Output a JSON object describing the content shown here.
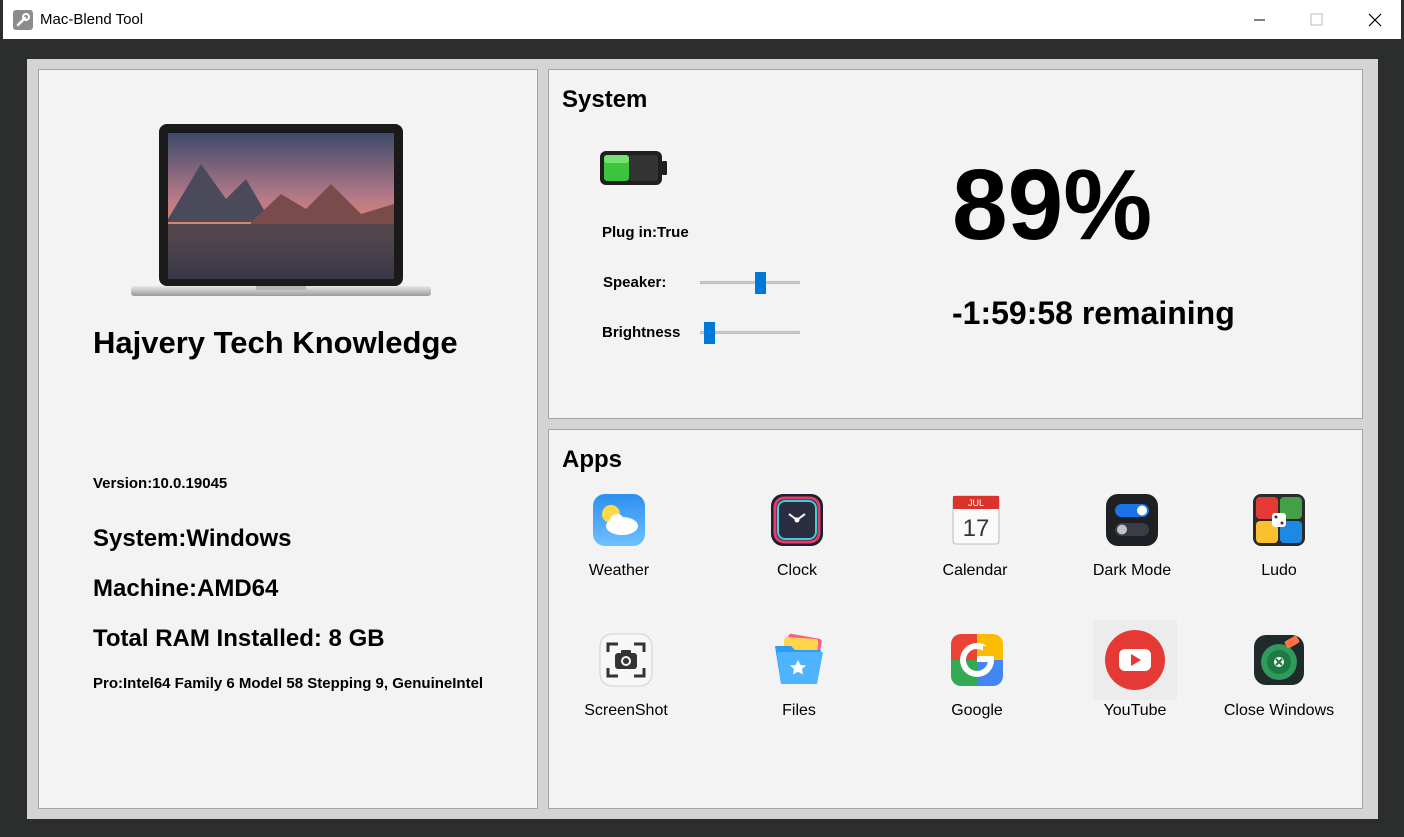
{
  "window": {
    "title": "Mac-Blend Tool"
  },
  "left": {
    "heading": "Hajvery Tech Knowledge",
    "version": "Version:10.0.19045",
    "system": "System:Windows",
    "machine": "Machine:AMD64",
    "ram": "Total RAM Installed:  8 GB",
    "processor": "Pro:Intel64 Family 6 Model 58 Stepping 9, GenuineIntel"
  },
  "system_panel": {
    "title": "System",
    "plug_in": "Plug in:True",
    "speaker_label": "Speaker:",
    "speaker_level": 0.62,
    "brightness_label": "Brightness",
    "brightness_level": 0.05,
    "battery_percent": "89%",
    "remaining": "-1:59:58 remaining"
  },
  "apps_panel": {
    "title": "Apps",
    "apps": [
      {
        "label": "Weather",
        "icon": "weather-icon"
      },
      {
        "label": "Clock",
        "icon": "clock-icon"
      },
      {
        "label": "Calendar",
        "icon": "calendar-icon",
        "calendar_month": "JUL",
        "calendar_day": "17"
      },
      {
        "label": "Dark Mode",
        "icon": "dark-mode-icon"
      },
      {
        "label": "Ludo",
        "icon": "ludo-icon"
      },
      {
        "label": "ScreenShot",
        "icon": "screenshot-icon"
      },
      {
        "label": "Files",
        "icon": "files-icon"
      },
      {
        "label": "Google",
        "icon": "google-icon"
      },
      {
        "label": "YouTube",
        "icon": "youtube-icon"
      },
      {
        "label": "Close Windows",
        "icon": "close-windows-icon"
      }
    ]
  },
  "colors": {
    "accent": "#0078d7",
    "battery_green": "#3cc43c",
    "panel_bg": "#f3f3f3",
    "frame_bg": "#d4d4d4",
    "window_bg": "#2b2e2d"
  }
}
